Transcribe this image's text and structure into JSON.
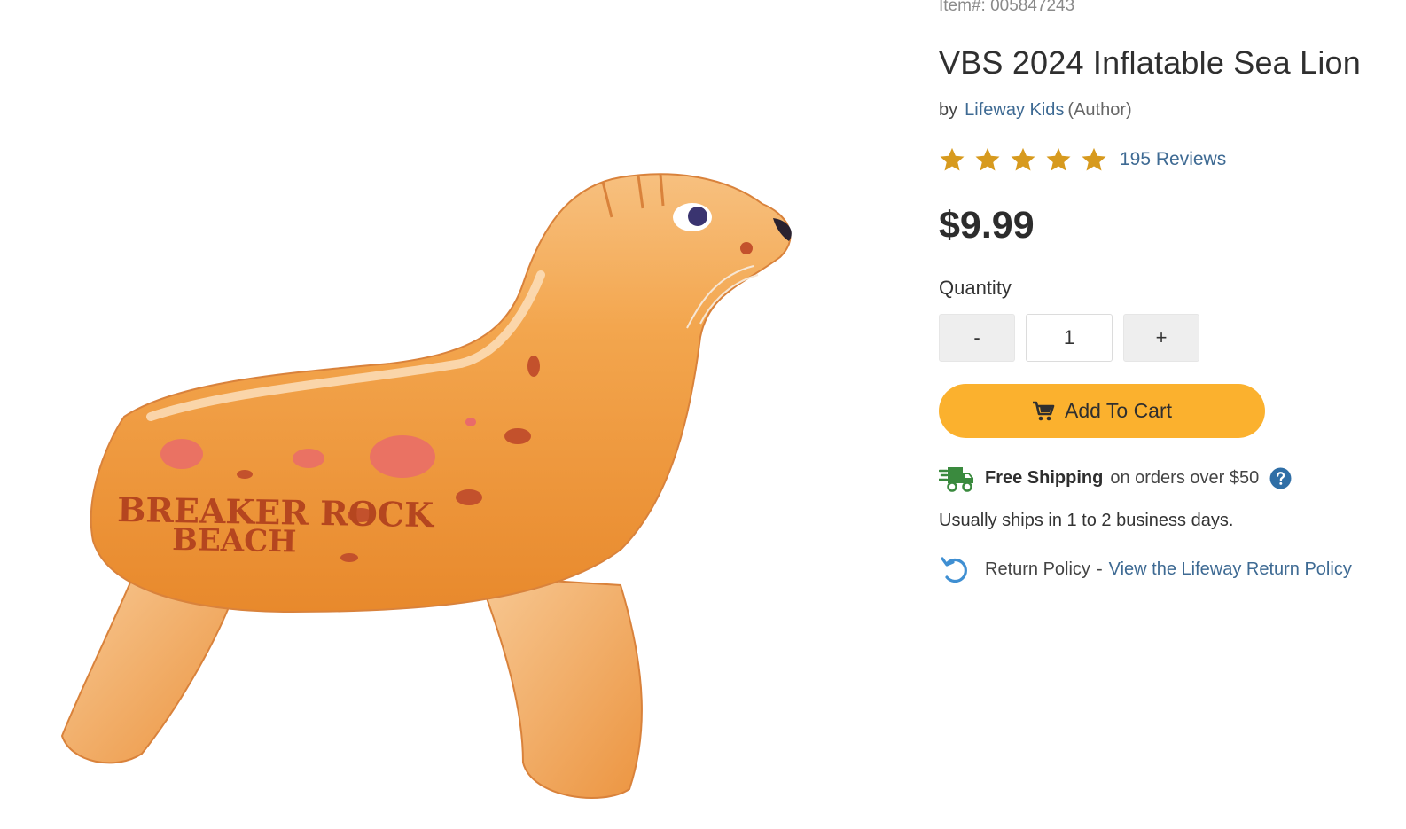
{
  "product": {
    "item_number": "Item#: 005847243",
    "title": "VBS 2024 Inflatable Sea Lion",
    "by_label": "by",
    "author": "Lifeway Kids",
    "author_role": "(Author)",
    "rating_stars": 5,
    "reviews_label": "195 Reviews",
    "price": "$9.99",
    "image": {
      "logo_line1": "BREAKER ROCK",
      "logo_line2": "BEACH"
    }
  },
  "purchase": {
    "quantity_label": "Quantity",
    "minus_label": "-",
    "quantity_value": "1",
    "plus_label": "+",
    "add_to_cart_label": "Add To Cart",
    "cart_icon": "cart-icon"
  },
  "shipping": {
    "free_label": "Free Shipping",
    "condition": "on orders over $50",
    "note": "Usually ships in 1 to 2 business days.",
    "truck_icon": "truck-icon",
    "help_icon": "question-circle-icon"
  },
  "returns": {
    "label": "Return Policy",
    "separator": "-",
    "link": "View the Lifeway Return Policy",
    "icon": "return-arrow-icon"
  },
  "colors": {
    "accent_button": "#fbb12e",
    "link": "#3e6a93",
    "star": "#d79a1e",
    "truck_green": "#3a8a3e",
    "help_blue": "#2f6ea6",
    "return_blue": "#3f8fd2"
  }
}
